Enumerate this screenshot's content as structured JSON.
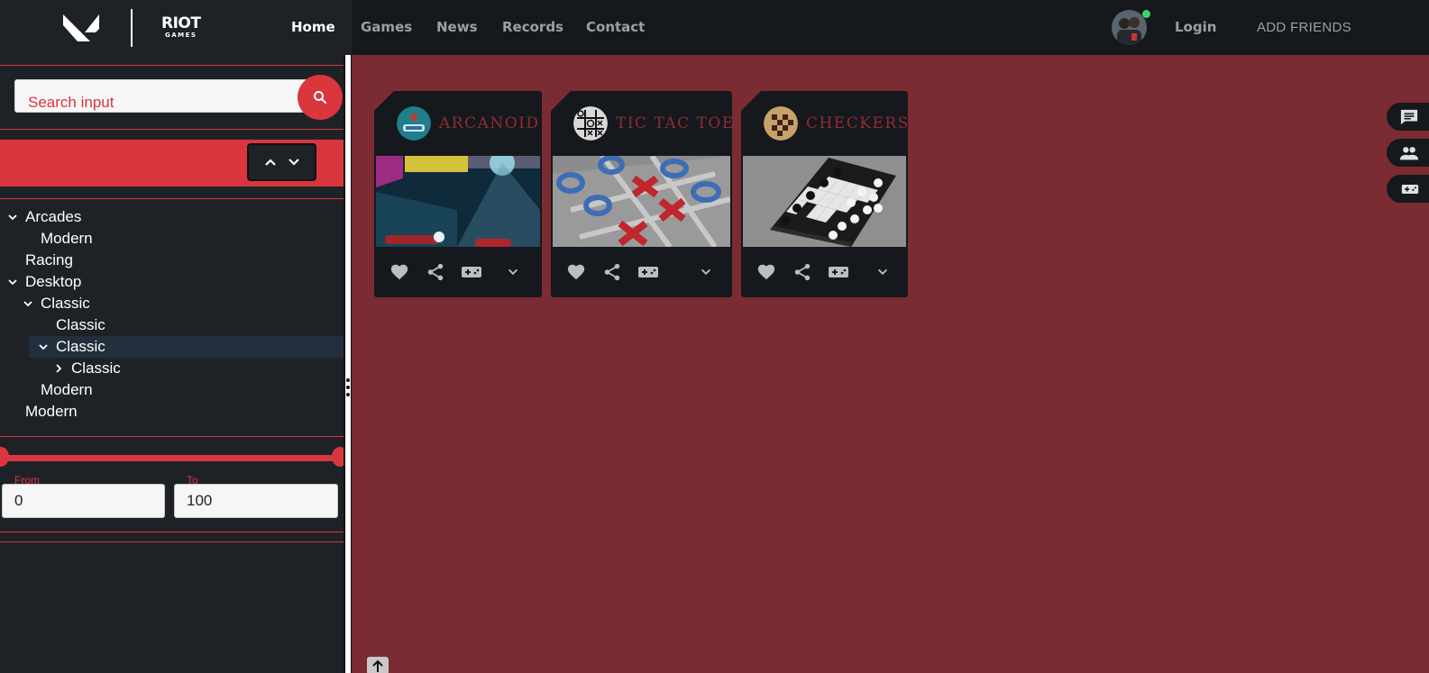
{
  "brand": {
    "logo_label": "RIOT",
    "logo_sub": "GAMES"
  },
  "nav": {
    "items": [
      {
        "label": "Home",
        "active": true
      },
      {
        "label": "Games"
      },
      {
        "label": "News"
      },
      {
        "label": "Records"
      },
      {
        "label": "Contact"
      }
    ],
    "login": "Login",
    "add_friends": "ADD FRIENDS",
    "online_status_color": "#3cd46a"
  },
  "sidebar": {
    "search": {
      "placeholder": "Search input"
    },
    "tree": [
      {
        "label": "Arcades",
        "toggle": "expanded"
      },
      {
        "label": "Modern"
      },
      {
        "label": "Racing"
      },
      {
        "label": "Desktop",
        "toggle": "expanded"
      },
      {
        "label": "Classic",
        "toggle": "expanded"
      },
      {
        "label": "Classic"
      },
      {
        "label": "Classic",
        "toggle": "expanded",
        "selected": true
      },
      {
        "label": "Classic",
        "toggle": "collapsed"
      },
      {
        "label": "Modern"
      },
      {
        "label": "Modern"
      }
    ],
    "range": {
      "from_label": "From",
      "to_label": "To",
      "from_value": "0",
      "to_value": "100"
    }
  },
  "games": [
    {
      "title": "ARCANOID",
      "icon": "arcanoid-logo"
    },
    {
      "title": "TIC TAC TOE",
      "icon": "tic-tac-toe-logo"
    },
    {
      "title": "CHECKERS",
      "icon": "checkers-logo"
    }
  ],
  "colors": {
    "accent": "#d9363e",
    "background": "#7b2b32",
    "panel": "#1e2226",
    "card": "#15181c",
    "card_title": "#8f2d35"
  }
}
